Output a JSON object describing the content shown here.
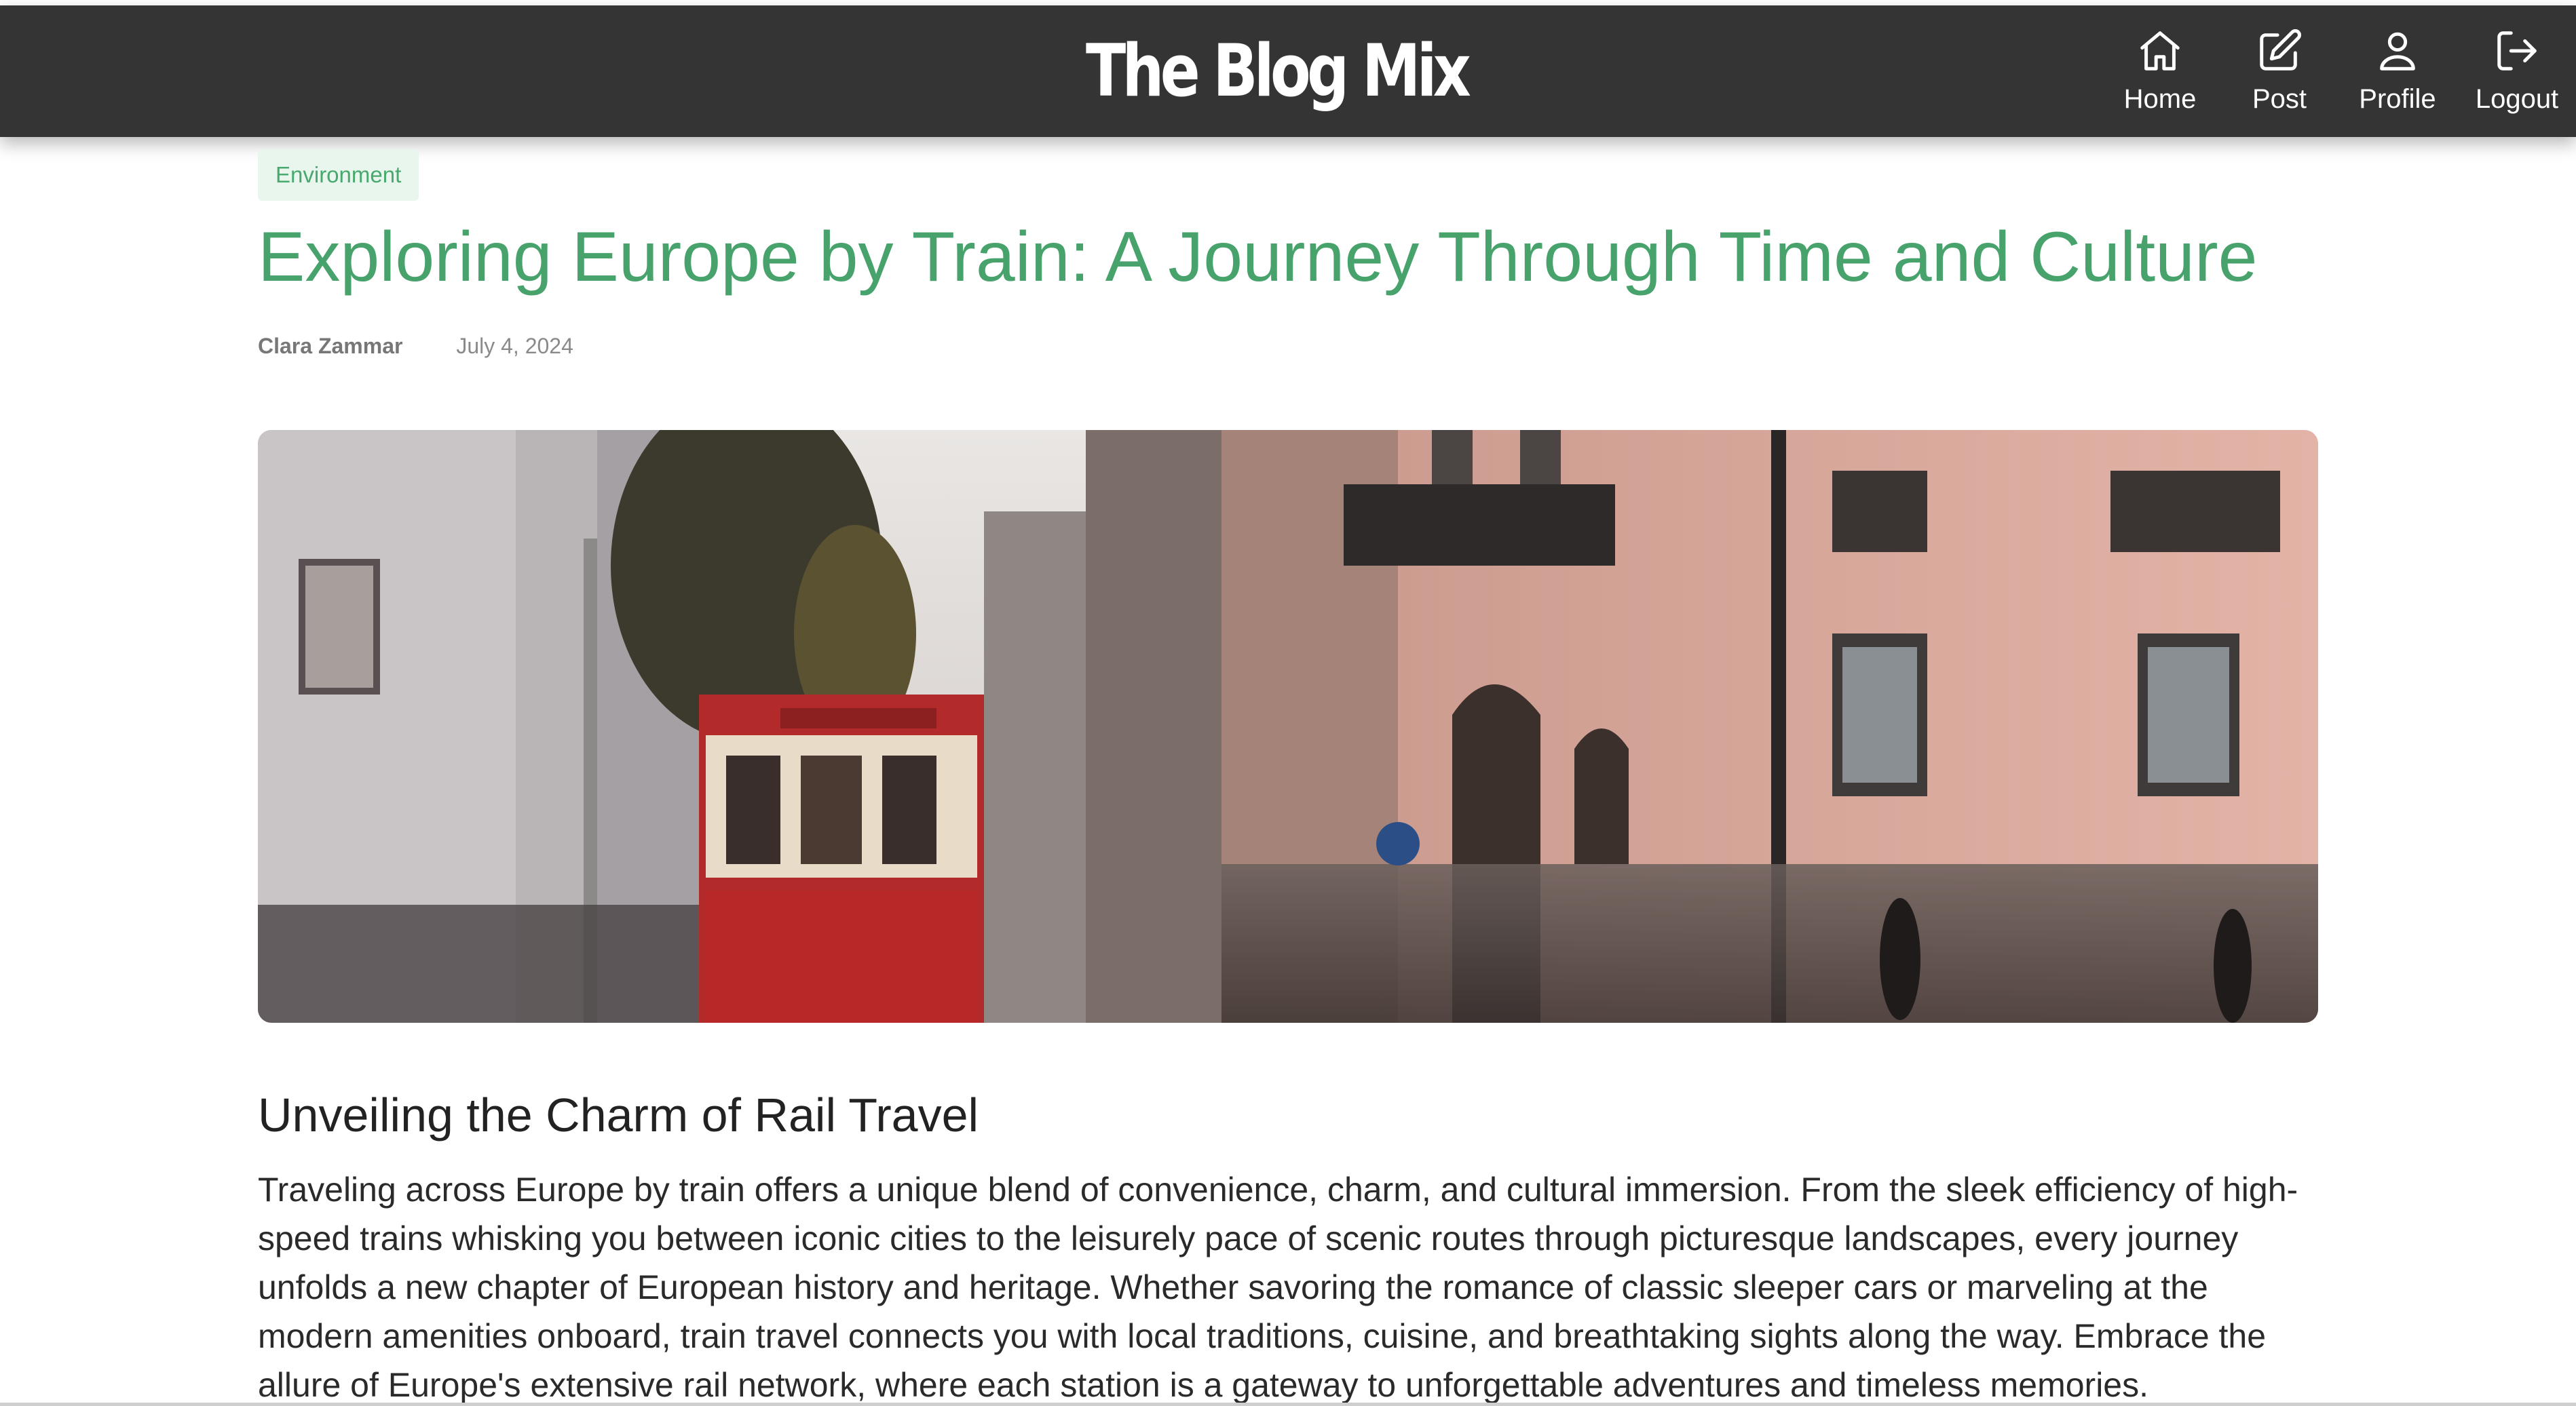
{
  "header": {
    "brand": "The Blog Mix",
    "nav": [
      {
        "label": "Home",
        "icon": "home-icon"
      },
      {
        "label": "Post",
        "icon": "edit-icon"
      },
      {
        "label": "Profile",
        "icon": "user-icon"
      },
      {
        "label": "Logout",
        "icon": "logout-icon"
      }
    ]
  },
  "article": {
    "category": "Environment",
    "title": "Exploring Europe by Train: A Journey Through Time and Culture",
    "author": "Clara Zammar",
    "date": "July 4, 2024",
    "section_heading": "Unveiling the Charm of Rail Travel",
    "body": "Traveling across Europe by train offers a unique blend of convenience, charm, and cultural immersion. From the sleek efficiency of high-speed trains whisking you between iconic cities to the leisurely pace of scenic routes through picturesque landscapes, every journey unfolds a new chapter of European history and heritage. Whether savoring the romance of classic sleeper cars or marveling at the modern amenities onboard, train travel connects you with local traditions, cuisine, and breathtaking sights along the way. Embrace the allure of Europe's extensive rail network, where each station is a gateway to unforgettable adventures and timeless memories."
  },
  "colors": {
    "navbar": "#343434",
    "accent": "#47a26c",
    "tag_bg": "#e9f6ee"
  }
}
